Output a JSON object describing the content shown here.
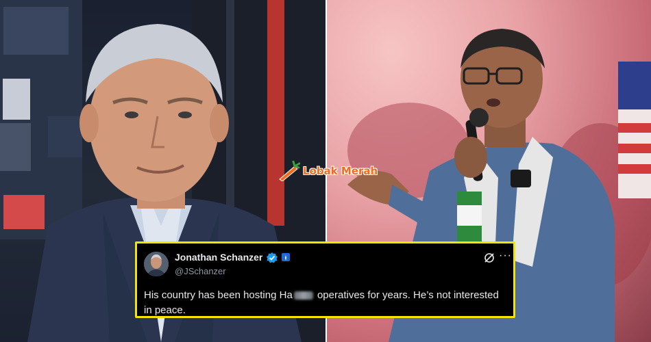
{
  "brand": {
    "logo_text": "Lobak Merah"
  },
  "tweet": {
    "author_name": "Jonathan Schanzer",
    "author_handle": "@JSchanzer",
    "body_before": "His country has been hosting Ha",
    "body_after": " operatives for years. He’s not interested in peace.",
    "more_icon": "···",
    "accent_color": "#f2e500"
  }
}
